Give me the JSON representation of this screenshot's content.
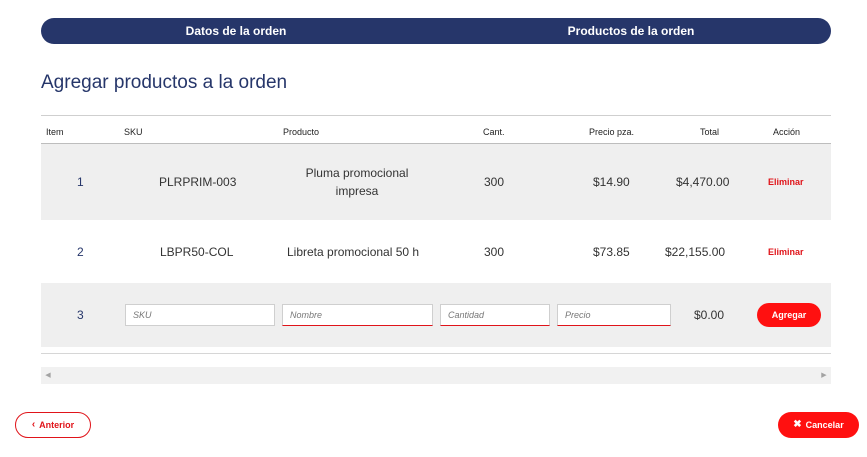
{
  "tabs": [
    {
      "label": "Datos de la orden"
    },
    {
      "label": "Productos de la orden"
    }
  ],
  "section_title": "Agregar productos a la orden",
  "table": {
    "headers": {
      "item": "Item",
      "sku": "SKU",
      "producto": "Producto",
      "cant": "Cant.",
      "precio": "Precio pza.",
      "total": "Total",
      "accion": "Acción"
    },
    "rows": [
      {
        "item": "1",
        "sku": "PLRPRIM-003",
        "producto": "Pluma promocional impresa",
        "producto_line1": "Pluma promocional",
        "producto_line2": "impresa",
        "cant": "300",
        "precio": "$14.90",
        "total": "$4,470.00",
        "action": "Eliminar"
      },
      {
        "item": "2",
        "sku": "LBPR50-COL",
        "producto": "Libreta promocional 50 h",
        "cant": "300",
        "precio": "$73.85",
        "total": "$22,155.00",
        "action": "Eliminar"
      }
    ],
    "new_row": {
      "item": "3",
      "sku_placeholder": "SKU",
      "nombre_placeholder": "Nombre",
      "cantidad_placeholder": "Cantidad",
      "precio_placeholder": "Precio",
      "total": "$0.00",
      "add_label": "Agregar"
    }
  },
  "footer": {
    "prev_label": "Anterior",
    "prev_icon": "chevron-left-icon",
    "cancel_label": "Cancelar",
    "cancel_icon": "close-icon"
  },
  "colors": {
    "navy": "#26366a",
    "red": "#ff1010",
    "row_alt": "#efefef"
  }
}
